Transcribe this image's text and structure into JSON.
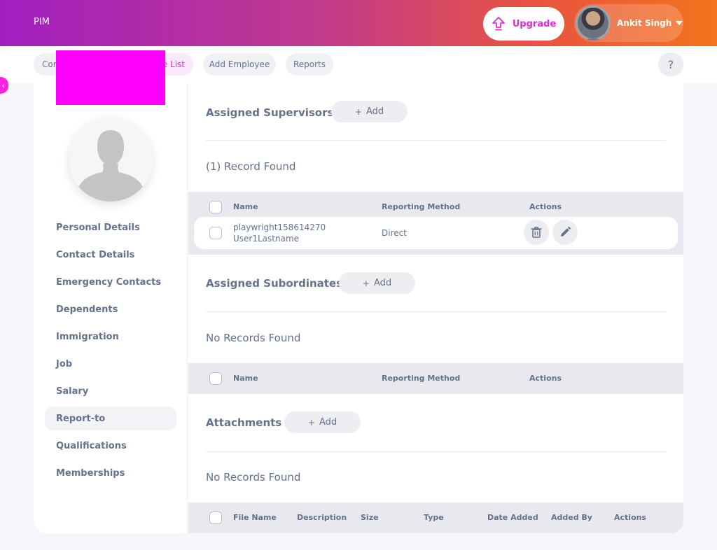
{
  "topbar": {
    "module": "PIM",
    "upgrade_label": "Upgrade",
    "user_name": "Ankit Singh"
  },
  "subnav": {
    "tabs": [
      {
        "label": "Con"
      },
      {
        "label": "e List"
      },
      {
        "label": "Add Employee"
      },
      {
        "label": "Reports"
      }
    ],
    "help": "?"
  },
  "sidebar": {
    "items": [
      {
        "label": "Personal Details"
      },
      {
        "label": "Contact Details"
      },
      {
        "label": "Emergency Contacts"
      },
      {
        "label": "Dependents"
      },
      {
        "label": "Immigration"
      },
      {
        "label": "Job"
      },
      {
        "label": "Salary"
      },
      {
        "label": "Report-to"
      },
      {
        "label": "Qualifications"
      },
      {
        "label": "Memberships"
      }
    ]
  },
  "supervisors": {
    "title": "Assigned Supervisors",
    "add_label": "Add",
    "count": "(1) Record Found",
    "columns": [
      "Name",
      "Reporting Method",
      "Actions"
    ],
    "rows": [
      {
        "name_line1": "playwright158614270",
        "name_line2": "User1Lastname",
        "method": "Direct"
      }
    ]
  },
  "subordinates": {
    "title": "Assigned Subordinates",
    "add_label": "Add",
    "count": "No Records Found",
    "columns": [
      "Name",
      "Reporting Method",
      "Actions"
    ]
  },
  "attachments": {
    "title": "Attachments",
    "add_label": "Add",
    "count": "No Records Found",
    "columns": [
      "File Name",
      "Description",
      "Size",
      "Type",
      "Date Added",
      "Added By",
      "Actions"
    ]
  },
  "colors": {
    "accent": "#e02bd8",
    "text": "#64728c",
    "header_bg": "#e8e8ee"
  }
}
